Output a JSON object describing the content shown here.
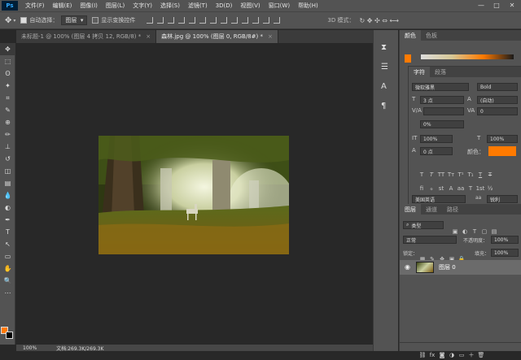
{
  "app": {
    "logo": "Ps"
  },
  "menu": [
    "文件(F)",
    "编辑(E)",
    "图像(I)",
    "图层(L)",
    "文字(Y)",
    "选择(S)",
    "滤镜(T)",
    "3D(D)",
    "视图(V)",
    "窗口(W)",
    "帮助(H)"
  ],
  "window_controls": {
    "minimize": "—",
    "maximize": "□",
    "close": "✕"
  },
  "options": {
    "auto_select_label": "自动选择：",
    "auto_select_value": "图层",
    "show_transform_label": "显示变换控件",
    "mode_3d": "3D 模式："
  },
  "tabs": [
    {
      "title": "未标题-1 @ 100% (图层 4 拷贝 12, RGB/8) *",
      "close": "×"
    },
    {
      "title": "森林.jpg @ 100% (图层 0, RGB/8#) *",
      "close": "×"
    }
  ],
  "tools": [
    "move-icon",
    "marquee-icon",
    "lasso-icon",
    "magic-wand-icon",
    "crop-icon",
    "eyedropper-icon",
    "healing-icon",
    "brush-icon",
    "stamp-icon",
    "history-brush-icon",
    "eraser-icon",
    "gradient-icon",
    "blur-icon",
    "dodge-icon",
    "pen-icon",
    "type-icon",
    "path-select-icon",
    "shape-icon",
    "hand-icon",
    "zoom-icon",
    "more-icon"
  ],
  "tool_glyphs": [
    "✥",
    "⬚",
    "ʘ",
    "✦",
    "⌗",
    "✎",
    "⊕",
    "✏",
    "⊥",
    "↺",
    "◫",
    "▤",
    "💧",
    "◐",
    "✒",
    "T",
    "↖",
    "▭",
    "✋",
    "🔍",
    "⋯"
  ],
  "colors": {
    "foreground": "#ff7a00",
    "background": "#000000",
    "accent": "#ff7a00"
  },
  "status": {
    "zoom": "100%",
    "doc": "文档:269.3K/269.3K"
  },
  "color_panel": {
    "tab1": "颜色",
    "tab2": "色板"
  },
  "char_panel": {
    "tab1": "字符",
    "tab2": "段落",
    "font_family": "微软雅黑",
    "font_style": "Bold",
    "font_size": "3 点",
    "leading": "(自动)",
    "kerning": "",
    "tracking": "0",
    "scale_pct": "0%",
    "vscale": "100%",
    "hscale": "100%",
    "baseline": "0 点",
    "color_label": "颜色：",
    "language": "美国英语",
    "antialias": "锐利",
    "aa_label": "aa"
  },
  "layers_panel": {
    "tab1": "图层",
    "tab2": "通道",
    "tab3": "路径",
    "filter_label": "类型",
    "blend_mode": "正常",
    "opacity_label": "不透明度：",
    "opacity": "100%",
    "lock_label": "锁定：",
    "fill_label": "填充：",
    "fill": "100%",
    "layer_name": "图层 0",
    "footer_fx": "fx"
  }
}
